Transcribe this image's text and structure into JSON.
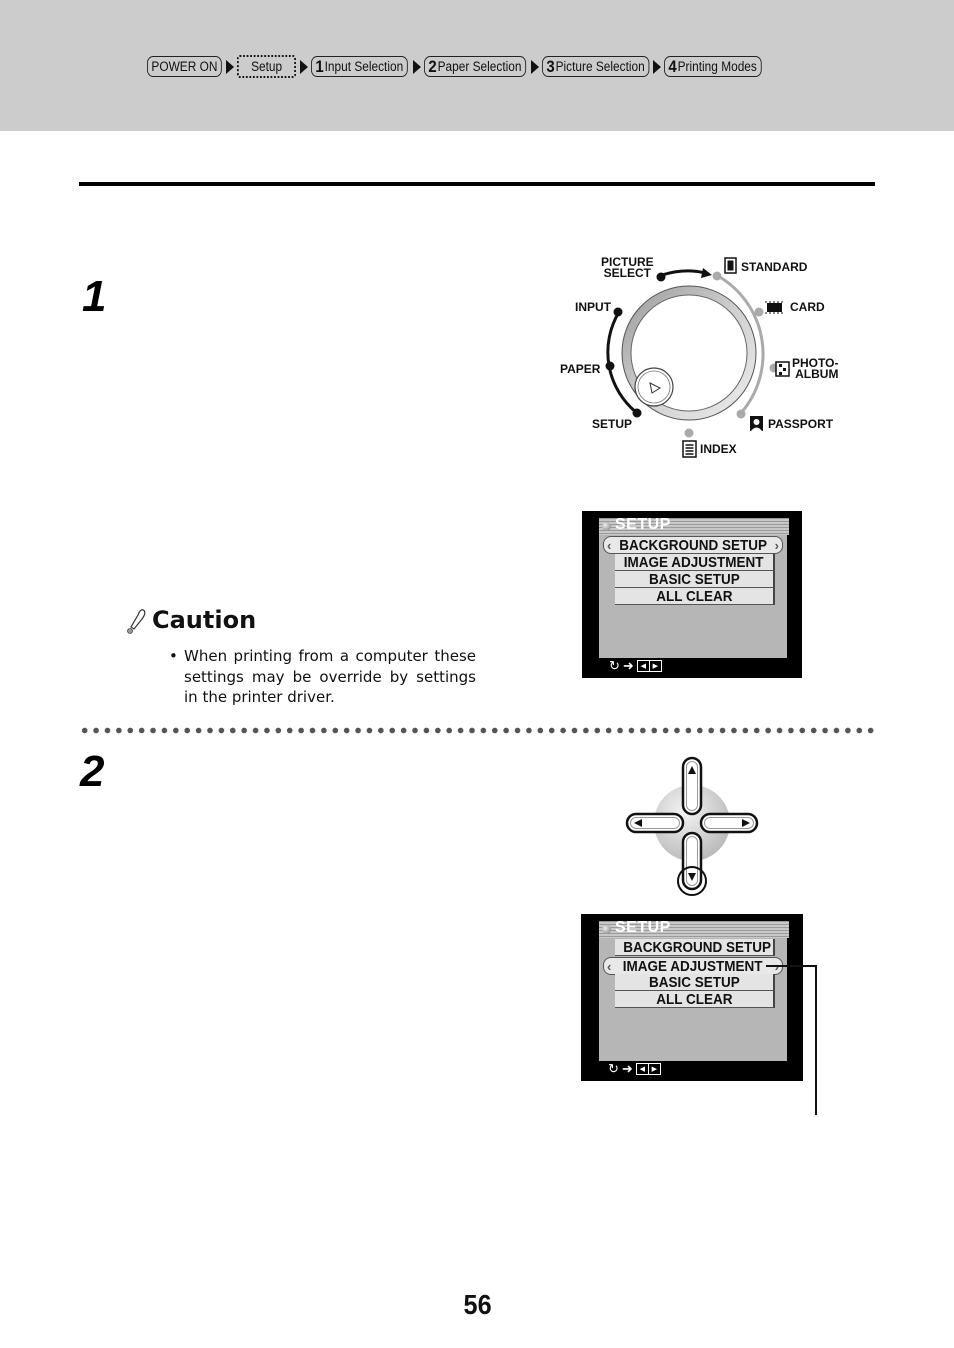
{
  "breadcrumb": {
    "items": [
      {
        "num": "",
        "label": "POWER ON",
        "style": "solid"
      },
      {
        "num": "",
        "label": "Setup",
        "style": "dotted"
      },
      {
        "num": "1",
        "label": "Input Selection",
        "style": "solid"
      },
      {
        "num": "2",
        "label": "Paper Selection",
        "style": "solid"
      },
      {
        "num": "3",
        "label": "Picture Selection",
        "style": "solid"
      },
      {
        "num": "4",
        "label": "Printing Modes",
        "style": "solid"
      }
    ]
  },
  "steps": [
    {
      "number": "1"
    },
    {
      "number": "2"
    }
  ],
  "dial": {
    "left_labels": [
      "PICTURE SELECT",
      "INPUT",
      "PAPER",
      "SETUP"
    ],
    "right_labels": [
      "STANDARD",
      "CARD",
      "PHOTO-ALBUM",
      "PASSPORT",
      "INDEX"
    ],
    "picture_select_line1": "PICTURE",
    "picture_select_line2": "SELECT",
    "photo_album_line1": "PHOTO-",
    "photo_album_line2": "ALBUM"
  },
  "caution": {
    "title": "Caution",
    "text": "When printing from a computer these settings may be override by settings in the printer driver.",
    "bullet": "•"
  },
  "lcd_screens": [
    {
      "title": "SETUP",
      "items": [
        "BACKGROUND SETUP",
        "IMAGE ADJUSTMENT",
        "BASIC SETUP",
        "ALL CLEAR"
      ],
      "selected_index": 0
    },
    {
      "title": "SETUP",
      "items": [
        "BACKGROUND SETUP",
        "IMAGE ADJUSTMENT",
        "BASIC SETUP",
        "ALL CLEAR"
      ],
      "selected_index": 1
    }
  ],
  "lcd_footer": {
    "cycle_icon": "↻",
    "arrow": "➜",
    "left": "◀",
    "right": "▶"
  },
  "dpad": {
    "up": "▲",
    "down": "▼",
    "left": "◀",
    "right": "▶",
    "highlighted": "down"
  },
  "page_number": "56",
  "colors": {
    "header_band": "#cccccc",
    "lcd_bg": "#000000",
    "lcd_screen": "#b6b6b6"
  }
}
